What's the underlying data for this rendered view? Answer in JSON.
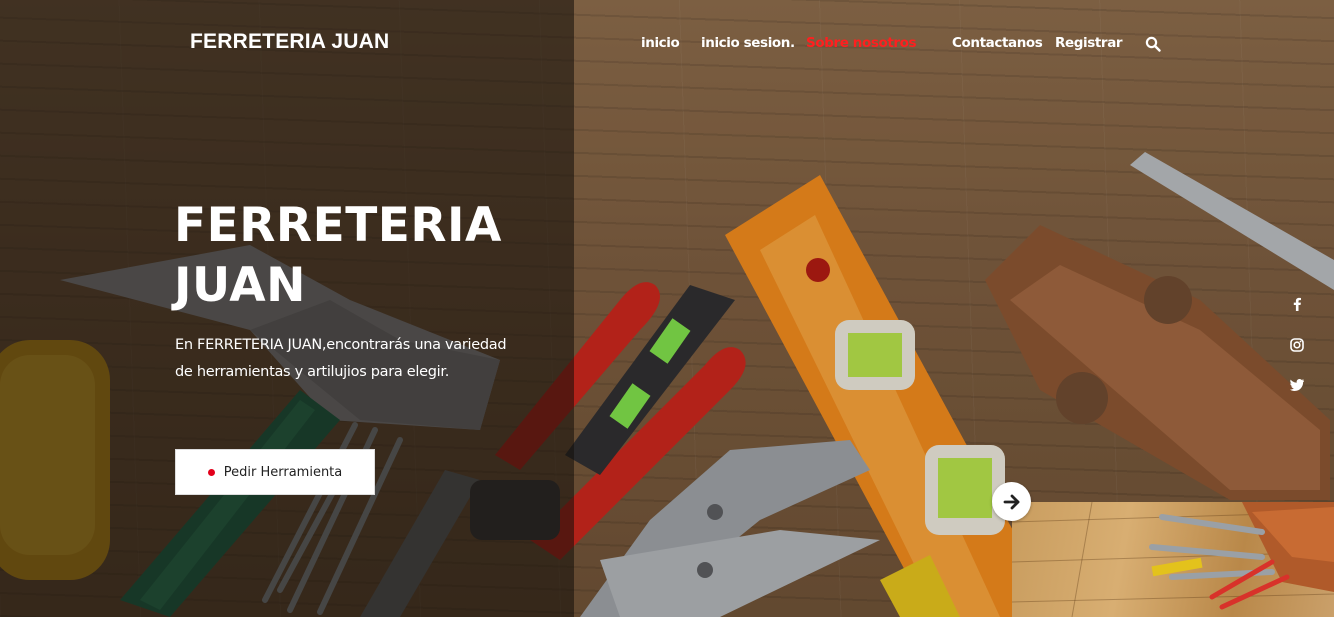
{
  "brand": {
    "name": "FERRETERIA JUAN"
  },
  "nav": {
    "items": [
      {
        "label": "inicio",
        "active": false
      },
      {
        "label": "inicio sesion.",
        "active": false
      },
      {
        "label": "Sobre nosotros",
        "active": true
      },
      {
        "label": "Contactanos",
        "active": false
      },
      {
        "label": "Registrar",
        "active": false
      }
    ],
    "search_icon": "search-icon"
  },
  "hero": {
    "title_line1": "FERRETERIA",
    "title_line2": "JUAN",
    "text_line1": "En FERRETERIA JUAN,encontrarás una variedad",
    "text_line2": "de herramientas y artilujios para elegir.",
    "button_label": "Pedir Herramienta"
  },
  "social": {
    "icons": [
      "facebook-icon",
      "instagram-icon",
      "twitter-icon"
    ]
  },
  "slider": {
    "next_icon": "arrow-right-icon"
  },
  "colors": {
    "accent": "#ff1f1f",
    "text": "#ffffff",
    "button_dot": "#e3001b"
  }
}
